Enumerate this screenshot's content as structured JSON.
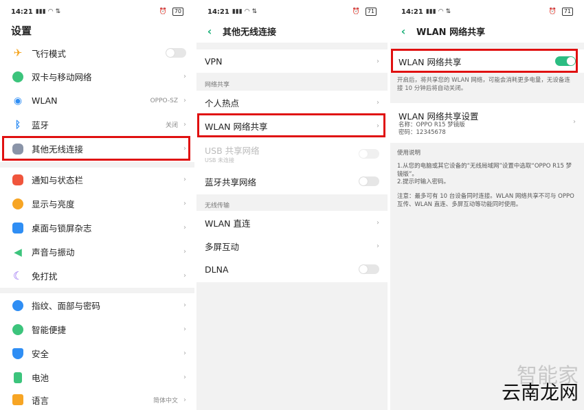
{
  "status": {
    "p1": {
      "time": "14:21",
      "battery": "70"
    },
    "p2": {
      "time": "14:21",
      "battery": "71"
    },
    "p3": {
      "time": "14:21",
      "battery": "71"
    }
  },
  "panel1": {
    "title": "设置",
    "items": [
      {
        "label": "飞行模式",
        "icon": "airplane-icon",
        "toggle": "off"
      },
      {
        "label": "双卡与移动网络",
        "icon": "globe-icon"
      },
      {
        "label": "WLAN",
        "icon": "wifi-icon",
        "value": "OPPO-SZ"
      },
      {
        "label": "蓝牙",
        "icon": "bluetooth-icon",
        "value": "关闭"
      },
      {
        "label": "其他无线连接",
        "icon": "more-connections-icon"
      },
      {
        "label": "通知与状态栏",
        "icon": "bell-icon"
      },
      {
        "label": "显示与亮度",
        "icon": "brightness-icon"
      },
      {
        "label": "桌面与锁屏杂志",
        "icon": "wallpaper-icon"
      },
      {
        "label": "声音与振动",
        "icon": "speaker-icon"
      },
      {
        "label": "免打扰",
        "icon": "moon-icon"
      },
      {
        "label": "指纹、面部与密码",
        "icon": "fingerprint-icon"
      },
      {
        "label": "智能便捷",
        "icon": "smart-icon"
      },
      {
        "label": "安全",
        "icon": "shield-icon"
      },
      {
        "label": "电池",
        "icon": "battery-icon"
      },
      {
        "label": "语言",
        "icon": "language-icon",
        "value": "简体中文"
      }
    ]
  },
  "panel2": {
    "title": "其他无线连接",
    "vpn": "VPN",
    "section_share": "网络共享",
    "hotspot": "个人热点",
    "wlan_share": "WLAN 网络共享",
    "usb_share": "USB 共享网络",
    "usb_sub": "USB 未连接",
    "bt_share": "蓝牙共享网络",
    "section_wireless": "无线传输",
    "wlan_direct": "WLAN 直连",
    "multiscreen": "多屏互动",
    "dlna": "DLNA"
  },
  "panel3": {
    "title": "WLAN 网络共享",
    "toggle_label": "WLAN 网络共享",
    "desc": "开启后，将共享您的 WLAN 网络，可能会消耗更多电量，无设备连接 10 分钟后将自动关闭。",
    "settings_title": "WLAN 网络共享设置",
    "name_line": "名称：OPPO R15 梦镜版",
    "password_line": "密码：12345678",
    "usage_title": "使用说明",
    "usage_1": "1.从您的电脑或其它设备的“无线局域网”设置中选取“OPPO R15 梦镜版”。",
    "usage_2": "2.提示时输入密码。",
    "note": "注意：最多可有 10 台设备同时连接。WLAN 网络共享不可与 OPPO 互传、WLAN 直连、多屏互动等功能同时使用。"
  },
  "watermark": {
    "top": "智能家",
    "bottom": "云南龙网"
  },
  "colors": {
    "accent": "#2bbd82",
    "highlight": "#e01010",
    "back": "#1db17a"
  }
}
